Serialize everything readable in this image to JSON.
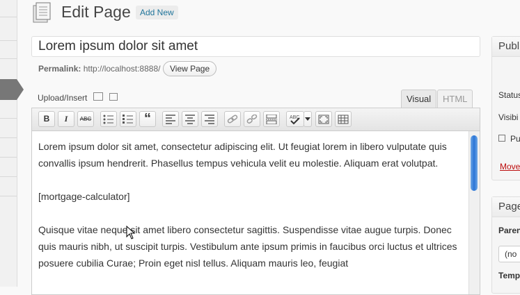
{
  "header": {
    "title": "Edit Page",
    "add_new": "Add New"
  },
  "post_title": {
    "value": "Lorem ipsum dolor sit amet"
  },
  "permalink": {
    "label": "Permalink:",
    "url": "http://localhost:8888/",
    "view_button": "View Page"
  },
  "upload": {
    "label": "Upload/Insert"
  },
  "editor_tabs": {
    "visual": "Visual",
    "html": "HTML"
  },
  "toolbar": {
    "bold": "B",
    "italic": "I",
    "strike": "ABC",
    "blockquote": "“"
  },
  "content": {
    "p1": "Lorem ipsum dolor sit amet, consectetur adipiscing elit. Ut feugiat lorem in libero vulputate quis convallis ipsum hendrerit. Phasellus tempus vehicula velit eu molestie. Aliquam erat volutpat.",
    "p2": "[mortgage-calculator]",
    "p3": "Quisque vitae neque sit amet libero consectetur sagittis. Suspendisse vitae augue turpis. Donec quis mauris nibh, ut suscipit turpis. Vestibulum ante ipsum primis in faucibus orci luctus et ultrices posuere cubilia Curae; Proin eget nisl tellus. Aliquam mauris leo, feugiat"
  },
  "sidebar": {
    "publish_head": "Publ",
    "status": "Status",
    "visibility": "Visibi",
    "published": "Pu",
    "move": "Move",
    "page_head": "Page",
    "parent": "Parent",
    "parent_value": "(no",
    "template": "Temp"
  }
}
